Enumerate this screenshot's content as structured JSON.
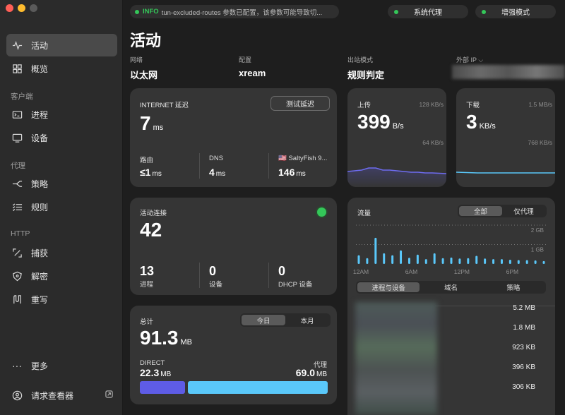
{
  "window": {
    "title": ""
  },
  "sidebar": {
    "items": [
      {
        "label": "活动",
        "icon": "activity-icon"
      },
      {
        "label": "概览",
        "icon": "grid-icon"
      },
      {
        "label": "进程",
        "icon": "terminal-icon"
      },
      {
        "label": "设备",
        "icon": "monitor-icon"
      },
      {
        "label": "策略",
        "icon": "branch-icon"
      },
      {
        "label": "规则",
        "icon": "list-icon"
      },
      {
        "label": "捕获",
        "icon": "capture-icon"
      },
      {
        "label": "解密",
        "icon": "shield-icon"
      },
      {
        "label": "重写",
        "icon": "rewrite-icon"
      },
      {
        "label": "更多",
        "icon": "more-icon"
      },
      {
        "label": "请求查看器",
        "icon": "viewer-icon"
      }
    ],
    "sections": [
      "客户端",
      "代理",
      "HTTP"
    ]
  },
  "topbar": {
    "log_level": "INFO",
    "log_text": "tun-excluded-routes 参数已配置，该参数可能导致切...",
    "system_proxy": "系统代理",
    "enhanced_mode": "增强模式"
  },
  "page": {
    "title": "活动",
    "network_label": "网络",
    "network_value": "以太网",
    "config_label": "配置",
    "config_value": "xream",
    "outbound_label": "出站模式",
    "outbound_value": "规则判定",
    "external_ip_label": "外部 IP ⌵"
  },
  "latency": {
    "title": "INTERNET 延迟",
    "value": "7",
    "unit": "ms",
    "test_button": "测试延迟",
    "router_label": "路由",
    "router_value": "≤1",
    "router_unit": "ms",
    "dns_label": "DNS",
    "dns_value": "4",
    "dns_unit": "ms",
    "proxy_label": "🇺🇸 SaltyFish 9...",
    "proxy_value": "146",
    "proxy_unit": "ms"
  },
  "upload": {
    "title": "上传",
    "value": "399",
    "unit": "B/s",
    "max": "128 KB/s",
    "mid": "64 KB/s"
  },
  "download": {
    "title": "下载",
    "value": "3",
    "unit": "KB/s",
    "max": "1.5 MB/s",
    "mid": "768 KB/s"
  },
  "connections": {
    "title": "活动连接",
    "value": "42",
    "processes": "13",
    "processes_label": "进程",
    "devices": "0",
    "devices_label": "设备",
    "dhcp": "0",
    "dhcp_label": "DHCP 设备"
  },
  "total": {
    "title": "总计",
    "today": "今日",
    "month": "本月",
    "value": "91.3",
    "unit": "MB",
    "direct_label": "DIRECT",
    "direct_value": "22.3",
    "direct_unit": "MB",
    "proxy_label": "代理",
    "proxy_value": "69.0",
    "proxy_unit": "MB",
    "direct_share": 0.244,
    "direct_color": "#5e5ce6",
    "proxy_color": "#5ac8fa"
  },
  "traffic": {
    "title": "流量",
    "seg_all": "全部",
    "seg_proxy": "仅代理",
    "y_max": "2 GB",
    "y_mid": "1 GB",
    "x_labels": [
      "12AM",
      "6AM",
      "12PM",
      "6PM"
    ],
    "tab_process": "进程与设备",
    "tab_domain": "域名",
    "tab_policy": "策略",
    "rows": [
      "5.2 MB",
      "1.8 MB",
      "923 KB",
      "396 KB",
      "306 KB"
    ]
  },
  "chart_data": {
    "type": "bar",
    "ylabel": "",
    "ylim": [
      0,
      2
    ],
    "values": [
      0.45,
      0.3,
      1.35,
      0.55,
      0.45,
      0.7,
      0.32,
      0.48,
      0.25,
      0.55,
      0.3,
      0.33,
      0.28,
      0.3,
      0.42,
      0.28,
      0.25,
      0.25,
      0.22,
      0.2,
      0.2,
      0.18,
      0.15
    ],
    "unit": "GB",
    "color": "#5ac8fa"
  }
}
